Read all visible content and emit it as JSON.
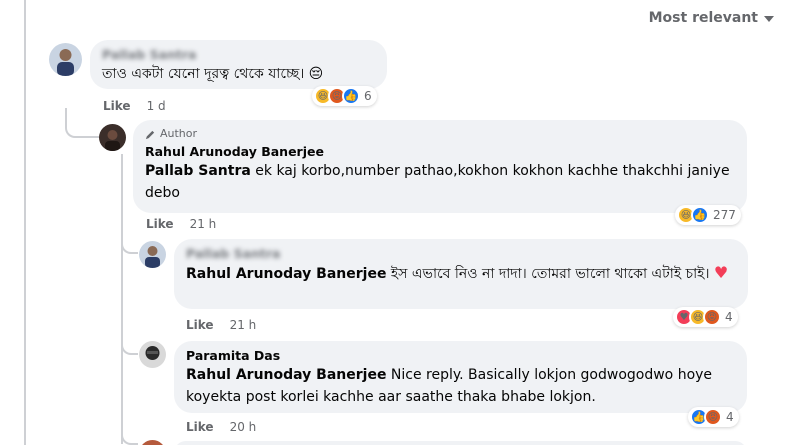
{
  "sort_label": "Most relevant",
  "colors": {
    "bubble": "#f0f2f5",
    "meta": "#65676b",
    "like_blue": "#1877f2",
    "haha_yellow": "#f7b928",
    "angry_orange": "#e0581e",
    "love_red": "#f33e58"
  },
  "comments": [
    {
      "name": "Pallab Santra",
      "text": "তাও একটা যেনো দূরত্ব থেকে যাচ্ছে। 😔",
      "like": "Like",
      "time": "1 d",
      "reaction_icons": [
        "haha",
        "angry",
        "like"
      ],
      "reaction_count": "6"
    },
    {
      "author_badge": "Author",
      "name": "Rahul Arunoday Banerjee",
      "tag": "Pallab Santra",
      "text": " ek kaj korbo,number pathao,kokhon kokhon kachhe thakchhi janiye debo",
      "like": "Like",
      "time": "21 h",
      "reaction_icons": [
        "haha",
        "like"
      ],
      "reaction_count": "277"
    },
    {
      "name": "Pallab Santra",
      "tag": "Rahul Arunoday Banerjee",
      "text": " ইস এভাবে নিও না দাদা। তোমরা ভালো থাকো এটাই চাই।",
      "like": "Like",
      "time": "21 h",
      "reaction_icons": [
        "love",
        "haha",
        "angry"
      ],
      "reaction_count": "4"
    },
    {
      "name": "Paramita Das",
      "tag": "Rahul Arunoday Banerjee",
      "text": " Nice reply. Basically lokjon godwogodwo hoye koyekta post korlei kachhe aar saathe thaka bhabe lokjon.",
      "like": "Like",
      "time": "20 h",
      "reaction_icons": [
        "like",
        "angry"
      ],
      "reaction_count": "4"
    }
  ]
}
